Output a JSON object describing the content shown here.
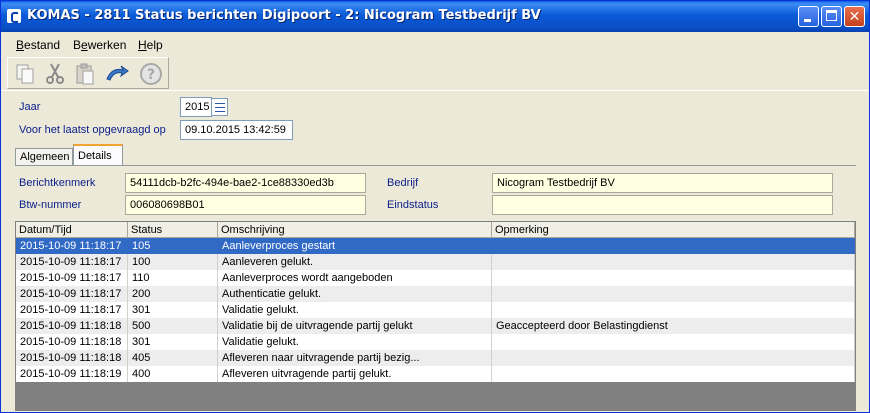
{
  "window": {
    "title": "KOMAS - 2811 Status berichten Digipoort - 2: Nicogram Testbedrijf BV"
  },
  "menu": [
    {
      "label": "Bestand",
      "accel": "B",
      "rest": "estand"
    },
    {
      "label": "Bewerken",
      "accel": "e",
      "pre": "B",
      "rest": "werken"
    },
    {
      "label": "Help",
      "accel": "H",
      "rest": "elp"
    }
  ],
  "toolbar": {
    "icons": [
      "copy-icon",
      "cut-icon",
      "paste-icon",
      "refresh-icon",
      "help-icon"
    ]
  },
  "form": {
    "jaar_label": "Jaar",
    "jaar_value": "2015",
    "laatst_label": "Voor het laatst opgevraagd op",
    "laatst_value": "09.10.2015 13:42:59"
  },
  "tabs": [
    {
      "label": "Algemeen",
      "active": false
    },
    {
      "label": "Details",
      "active": true
    }
  ],
  "details": {
    "berichtkenmerk_label": "Berichtkenmerk",
    "berichtkenmerk_value": "54111dcb-b2fc-494e-bae2-1ce88330ed3b",
    "btw_label": "Btw-nummer",
    "btw_value": "006080698B01",
    "bedrijf_label": "Bedrijf",
    "bedrijf_value": "Nicogram Testbedrijf BV",
    "eindstatus_label": "Eindstatus",
    "eindstatus_value": ""
  },
  "table": {
    "columns": [
      "Datum/Tijd",
      "Status",
      "Omschrijving",
      "Opmerking"
    ],
    "rows": [
      [
        "2015-10-09 11:18:17",
        "105",
        "Aanleverproces gestart",
        ""
      ],
      [
        "2015-10-09 11:18:17",
        "100",
        "Aanleveren gelukt.",
        ""
      ],
      [
        "2015-10-09 11:18:17",
        "110",
        "Aanleverproces wordt aangeboden",
        ""
      ],
      [
        "2015-10-09 11:18:17",
        "200",
        "Authenticatie gelukt.",
        ""
      ],
      [
        "2015-10-09 11:18:17",
        "301",
        "Validatie gelukt.",
        ""
      ],
      [
        "2015-10-09 11:18:18",
        "500",
        "Validatie bij de uitvragende partij gelukt",
        "Geaccepteerd door Belastingdienst"
      ],
      [
        "2015-10-09 11:18:18",
        "301",
        "Validatie gelukt.",
        ""
      ],
      [
        "2015-10-09 11:18:18",
        "405",
        "Afleveren naar uitvragende partij bezig...",
        ""
      ],
      [
        "2015-10-09 11:18:19",
        "400",
        "Afleveren uitvragende partij gelukt.",
        ""
      ]
    ],
    "selected_row": 0
  },
  "colors": {
    "titlebar": "#0a5ce6",
    "selection": "#316ac5",
    "label_text": "#0a1e8a",
    "readonly_field": "#ffffe1"
  }
}
